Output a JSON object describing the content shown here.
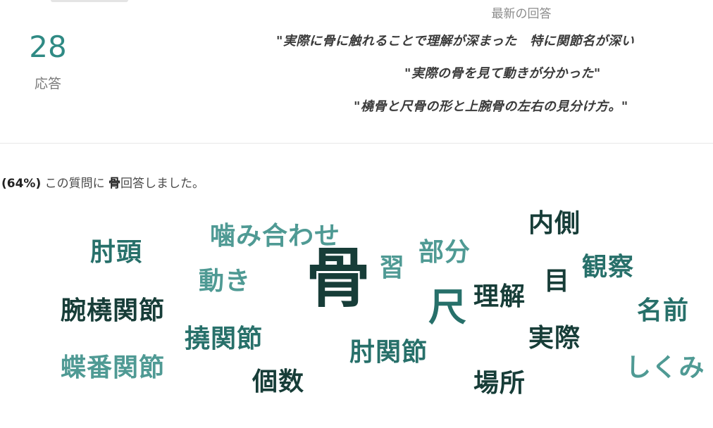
{
  "summary": {
    "count": "28",
    "count_label": "応答"
  },
  "latest": {
    "title": "最新の回答",
    "responses": [
      "\"実際に骨に触れることで理解が深まった　特に関節名が深い",
      "\"実際の骨を見て動きが分かった\"",
      "\"橈骨と尺骨の形と上腕骨の左右の見分け方。\""
    ]
  },
  "stat": {
    "percent": "(64%)",
    "prefix": "この質問に",
    "keyword": "骨",
    "suffix": "回答しました。"
  },
  "colors": {
    "dark": "#173d38",
    "mid": "#27706a",
    "light": "#4f9a94",
    "accent": "#2f8a84"
  },
  "word_cloud": [
    {
      "text": "噛み合わせ",
      "weight": 3,
      "tone": "light"
    },
    {
      "text": "内側",
      "weight": 3,
      "tone": "dark"
    },
    {
      "text": "肘頭",
      "weight": 3,
      "tone": "mid"
    },
    {
      "text": "部分",
      "weight": 3,
      "tone": "light"
    },
    {
      "text": "骨",
      "weight": 10,
      "tone": "dark"
    },
    {
      "text": "習",
      "weight": 2,
      "tone": "light"
    },
    {
      "text": "観察",
      "weight": 3,
      "tone": "mid"
    },
    {
      "text": "動き",
      "weight": 3,
      "tone": "light"
    },
    {
      "text": "目",
      "weight": 3,
      "tone": "dark"
    },
    {
      "text": "理解",
      "weight": 3,
      "tone": "dark"
    },
    {
      "text": "尺",
      "weight": 5,
      "tone": "mid"
    },
    {
      "text": "名前",
      "weight": 3,
      "tone": "mid"
    },
    {
      "text": "腕橈関節",
      "weight": 3,
      "tone": "dark"
    },
    {
      "text": "実際",
      "weight": 3,
      "tone": "dark"
    },
    {
      "text": "撓関節",
      "weight": 3,
      "tone": "mid"
    },
    {
      "text": "肘関節",
      "weight": 3,
      "tone": "mid"
    },
    {
      "text": "蝶番関節",
      "weight": 3,
      "tone": "light"
    },
    {
      "text": "しくみ",
      "weight": 3,
      "tone": "light"
    },
    {
      "text": "個数",
      "weight": 3,
      "tone": "dark"
    },
    {
      "text": "場所",
      "weight": 3,
      "tone": "dark"
    }
  ]
}
